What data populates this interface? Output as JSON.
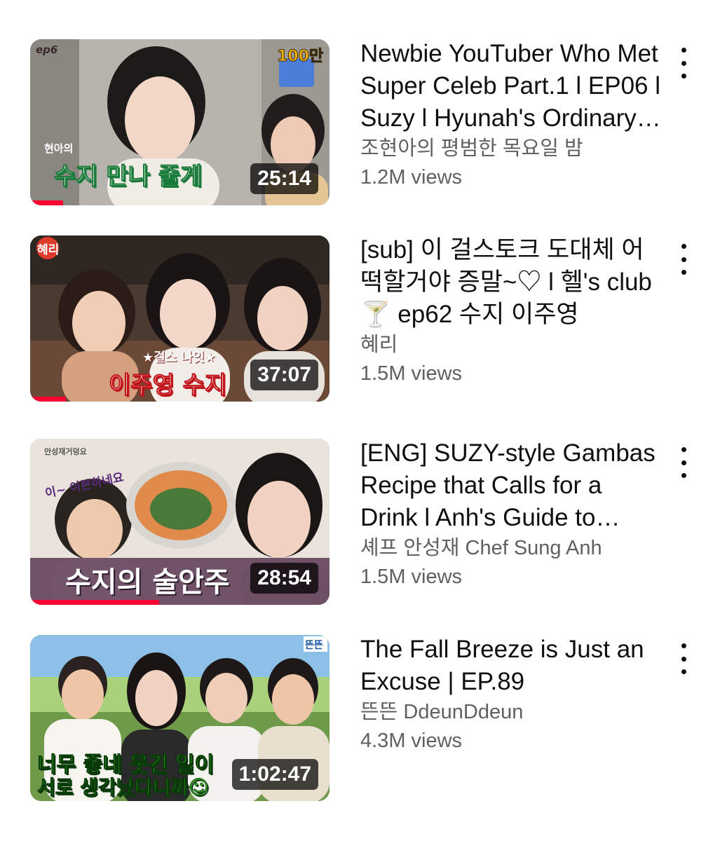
{
  "accent_color": "#ff0033",
  "videos": [
    {
      "title": "Newbie YouTuber Who Met Super Celeb Part.1 l EP06 l Suzy l Hyunah's Ordinary Thursday Night",
      "channel": "조현아의 평범한 목요일 밤",
      "views": "1.2M views",
      "duration": "25:14",
      "progress": 0.11,
      "thumb_text": [
        "ep6",
        "100만",
        "현아의",
        "수지 만나 줄게"
      ],
      "menu_icon": "more-vert-icon"
    },
    {
      "title": "[sub] 이 걸스토크 도대체 어떡할거야 증말~♡ l 헬's club🍸 ep62 수지 이주영",
      "channel": "혜리",
      "views": "1.5M views",
      "duration": "37:07",
      "progress": 0.12,
      "thumb_text": [
        "혜리",
        "★걸스 나잇★",
        "이주영 수지"
      ],
      "menu_icon": "more-vert-icon"
    },
    {
      "title": "[ENG] SUZY-style Gambas Recipe that Calls for a Drink l Anh's Guide to Dominating Cooking",
      "channel": "셰프 안성재 Chef Sung Anh",
      "views": "1.5M views",
      "duration": "28:54",
      "progress": 0.43,
      "thumb_text": [
        "안성재거덩요",
        "이~ 이븐하네요",
        "수지의 술안주"
      ],
      "menu_icon": "more-vert-icon"
    },
    {
      "title": "The Fall Breeze is Just an Excuse | EP.89",
      "channel": "뜬뜬 DdeunDdeun",
      "views": "4.3M views",
      "duration": "1:02:47",
      "progress": 0,
      "thumb_text": [
        "뜬뜬",
        "너무 좋네 웃긴 일이",
        "서로 생각났다니까☺"
      ],
      "menu_icon": "more-vert-icon"
    }
  ]
}
